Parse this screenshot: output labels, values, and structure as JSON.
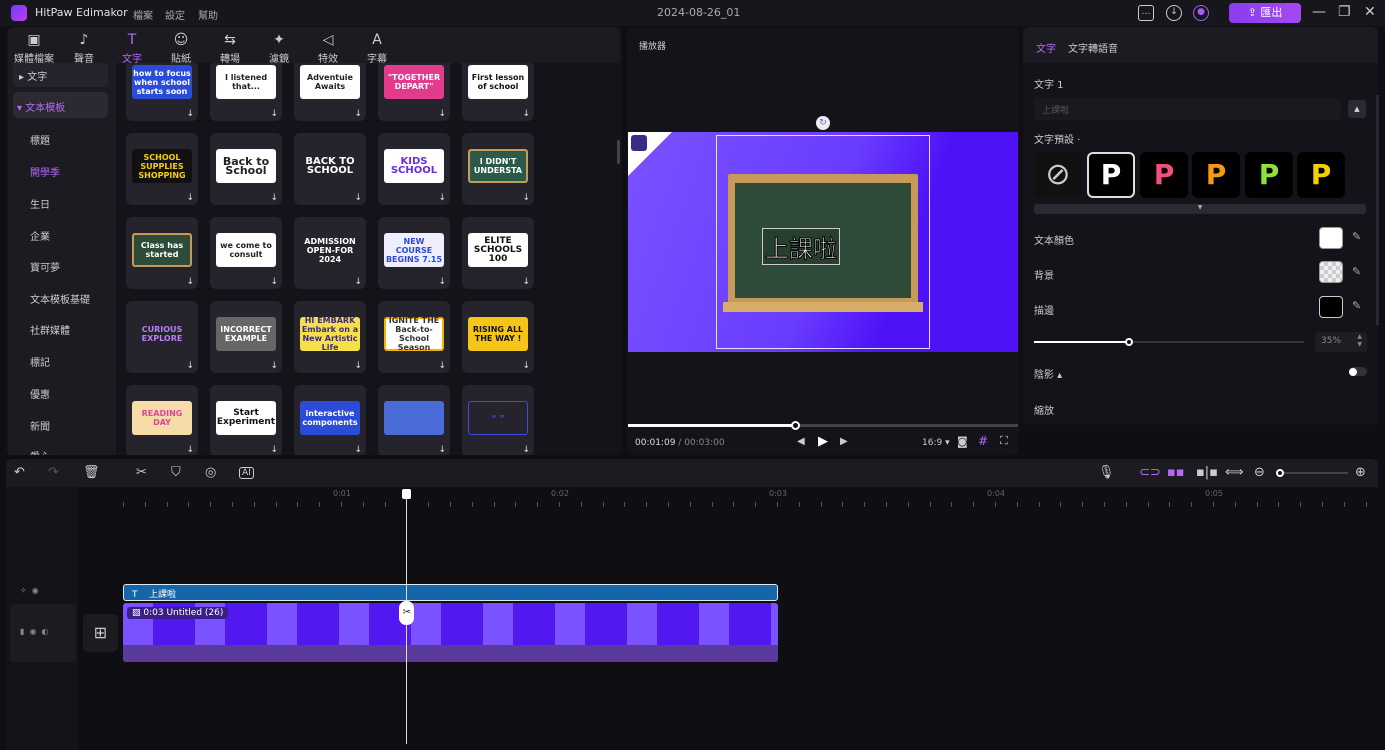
{
  "app": {
    "title": "HitPaw Edimakor",
    "project_date": "2024-08-26_01",
    "menus": [
      "檔案",
      "設定",
      "幫助"
    ],
    "export_label": "匯出"
  },
  "toolbar": {
    "tabs": [
      {
        "label": "媒體檔案",
        "icon": "media-icon"
      },
      {
        "label": "聲音",
        "icon": "music-icon"
      },
      {
        "label": "文字",
        "icon": "text-icon",
        "active": true
      },
      {
        "label": "貼紙",
        "icon": "sticker-icon"
      },
      {
        "label": "轉場",
        "icon": "transition-icon"
      },
      {
        "label": "濾鏡",
        "icon": "filter-icon"
      },
      {
        "label": "特效",
        "icon": "effect-icon"
      },
      {
        "label": "字幕",
        "icon": "subtitle-icon"
      }
    ]
  },
  "sidebar": {
    "sections": [
      {
        "label": "文字",
        "expanded": false
      },
      {
        "label": "文本模板",
        "expanded": true
      }
    ],
    "items": [
      "標題",
      "開學季",
      "生日",
      "企業",
      "寶可夢",
      "文本模板基礎",
      "社群媒體",
      "標記",
      "優惠",
      "新聞",
      "愛心"
    ],
    "active_item": "開學季"
  },
  "templates": [
    [
      "how to focus when school starts soon",
      "I listened that...",
      "Adventuie Awaits",
      "\"TOGETHER DEPART\"",
      "First lesson of school"
    ],
    [
      "SCHOOL SUPPLIES SHOPPING",
      "Back to School",
      "BACK TO SCHOOL",
      "KIDS SCHOOL",
      "I DIDN'T UNDERSTA"
    ],
    [
      "Class has started",
      "we come to consult",
      "ADMISSION OPEN-FOR 2024",
      "NEW COURSE BEGINS 7.15",
      "ELITE SCHOOLS 100"
    ],
    [
      "CURIOUS EXPLORE",
      "INCORRECT EXAMPLE",
      "HI EMBARK Embark on a New Artistic Life",
      "IGNITE THE Back-to-School Season",
      "RISING ALL THE WAY !"
    ],
    [
      "READING DAY",
      "Start Experiment",
      "interactive components",
      "",
      "“ ”"
    ]
  ],
  "player": {
    "title": "播放器",
    "overlay_text": "上課啦",
    "current_time": "00:01:09",
    "total_time": "00:03:00",
    "progress": 0.43,
    "aspect_ratio": "16:9"
  },
  "properties": {
    "tabs": [
      "文字",
      "文字轉語音"
    ],
    "active_tab": "文字",
    "text_label": "文字 1",
    "text_value": "上課啦",
    "preset_label": "文字預設",
    "presets": [
      {
        "letter": "",
        "color": "#cccccc"
      },
      {
        "letter": "P",
        "color": "#ffffff"
      },
      {
        "letter": "P",
        "color": "#f0507a"
      },
      {
        "letter": "P",
        "color": "#f59a10"
      },
      {
        "letter": "P",
        "color": "#8ee23a"
      },
      {
        "letter": "P",
        "color": "#f5d000"
      }
    ],
    "text_color_label": "文本顏色",
    "text_color": "#ffffff",
    "background_label": "背景",
    "stroke_label": "描邊",
    "stroke_color": "#000000",
    "opacity_value": "35%",
    "opacity": 0.35,
    "shadow_label": "陰影",
    "shadow_enabled": false,
    "scale_label": "縮放"
  },
  "timeline": {
    "ruler": [
      "0:01",
      "0:02",
      "0:03",
      "0:04",
      "0:05"
    ],
    "text_clip": "上課啦",
    "video_clip": "0:03 Untitled (26)",
    "playhead_seconds": 1.3
  }
}
